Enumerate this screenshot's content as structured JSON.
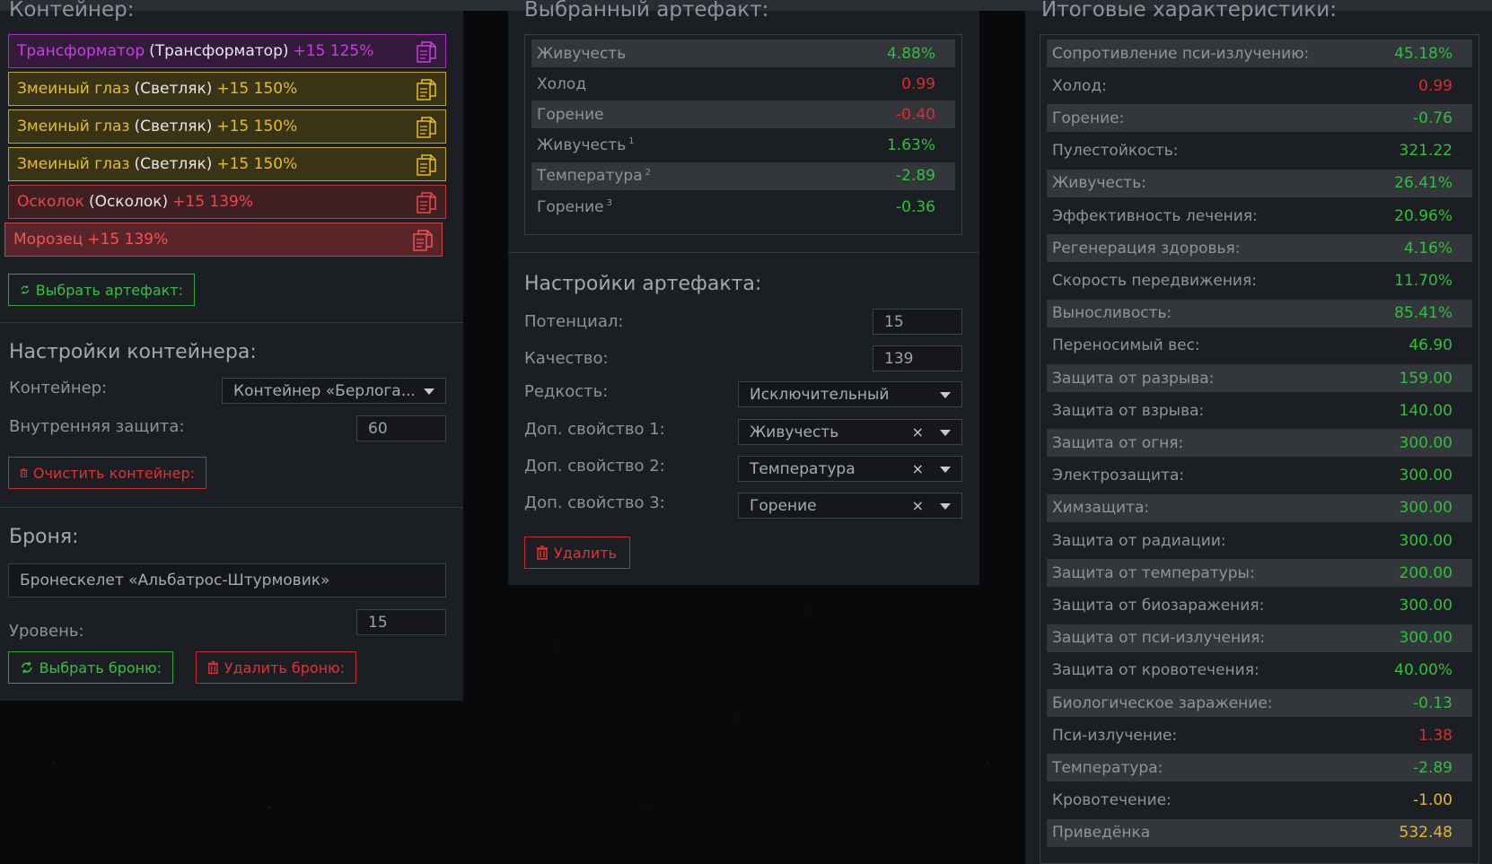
{
  "left": {
    "container_title": "Контейнер:",
    "artifacts": [
      {
        "name": "Трансформатор",
        "sub": "(Трансформатор)",
        "level": "+15 125%",
        "style": "purple"
      },
      {
        "name": "Змеиный глаз",
        "sub": "(Светляк)",
        "level": "+15 150%",
        "style": "yellow"
      },
      {
        "name": "Змеиный глаз",
        "sub": "(Светляк)",
        "level": "+15 150%",
        "style": "yellow"
      },
      {
        "name": "Змеиный глаз",
        "sub": "(Светляк)",
        "level": "+15 150%",
        "style": "yellow"
      },
      {
        "name": "Осколок",
        "sub": "(Осколок)",
        "level": "+15 139%",
        "style": "red"
      },
      {
        "name": "Морозец",
        "sub": "",
        "level": "+15 139%",
        "style": "red2"
      }
    ],
    "select_artifact_label": "Выбрать артефакт:",
    "container_settings_title": "Настройки контейнера:",
    "container_label": "Контейнер:",
    "container_value": "Контейнер «Берлога...",
    "inner_protection_label": "Внутренняя защита:",
    "inner_protection_value": "60",
    "clear_container_label": "Очистить контейнер:",
    "armor_title": "Броня:",
    "armor_value": "Бронескелет «Альбатрос-Штурмовик»",
    "level_label": "Уровень:",
    "level_value": "15",
    "select_armor_label": "Выбрать броню:",
    "delete_armor_label": "Удалить броню:"
  },
  "middle": {
    "selected_title": "Выбранный артефакт:",
    "stats": [
      {
        "name": "Живучесть",
        "sup": "",
        "value": "4.88%",
        "color": "green"
      },
      {
        "name": "Холод",
        "sup": "",
        "value": "0.99",
        "color": "red"
      },
      {
        "name": "Горение",
        "sup": "",
        "value": "-0.40",
        "color": "red"
      },
      {
        "name": "Живучесть",
        "sup": "1",
        "value": "1.63%",
        "color": "green"
      },
      {
        "name": "Температура",
        "sup": "2",
        "value": "-2.89",
        "color": "green"
      },
      {
        "name": "Горение",
        "sup": "3",
        "value": "-0.36",
        "color": "green"
      }
    ],
    "settings_title": "Настройки артефакта:",
    "potential_label": "Потенциал:",
    "potential_value": "15",
    "quality_label": "Качество:",
    "quality_value": "139",
    "rarity_label": "Редкость:",
    "rarity_value": "Исключительный",
    "extra1_label": "Доп. свойство 1:",
    "extra1_value": "Живучесть",
    "extra2_label": "Доп. свойство 2:",
    "extra2_value": "Температура",
    "extra3_label": "Доп. свойство 3:",
    "extra3_value": "Горение",
    "clear_symbol": "×",
    "delete_label": "Удалить"
  },
  "right": {
    "title": "Итоговые характеристики:",
    "stats": [
      {
        "name": "Сопротивление пси-излучению:",
        "value": "45.18%",
        "color": "green"
      },
      {
        "name": "Холод:",
        "value": "0.99",
        "color": "red"
      },
      {
        "name": "Горение:",
        "value": "-0.76",
        "color": "green"
      },
      {
        "name": "Пулестойкость:",
        "value": "321.22",
        "color": "green"
      },
      {
        "name": "Живучесть:",
        "value": "26.41%",
        "color": "green"
      },
      {
        "name": "Эффективность лечения:",
        "value": "20.96%",
        "color": "green"
      },
      {
        "name": "Регенерация здоровья:",
        "value": "4.16%",
        "color": "green"
      },
      {
        "name": "Скорость передвижения:",
        "value": "11.70%",
        "color": "green"
      },
      {
        "name": "Выносливость:",
        "value": "85.41%",
        "color": "green"
      },
      {
        "name": "Переносимый вес:",
        "value": "46.90",
        "color": "green"
      },
      {
        "name": "Защита от разрыва:",
        "value": "159.00",
        "color": "green"
      },
      {
        "name": "Защита от взрыва:",
        "value": "140.00",
        "color": "green"
      },
      {
        "name": "Защита от огня:",
        "value": "300.00",
        "color": "green"
      },
      {
        "name": "Электрозащита:",
        "value": "300.00",
        "color": "green"
      },
      {
        "name": "Химзащита:",
        "value": "300.00",
        "color": "green"
      },
      {
        "name": "Защита от радиации:",
        "value": "300.00",
        "color": "green"
      },
      {
        "name": "Защита от температуры:",
        "value": "200.00",
        "color": "green"
      },
      {
        "name": "Защита от биозаражения:",
        "value": "300.00",
        "color": "green"
      },
      {
        "name": "Защита от пси-излучения:",
        "value": "300.00",
        "color": "green"
      },
      {
        "name": "Защита от кровотечения:",
        "value": "40.00%",
        "color": "green"
      },
      {
        "name": "Биологическое заражение:",
        "value": "-0.13",
        "color": "green"
      },
      {
        "name": "Пси-излучение:",
        "value": "1.38",
        "color": "red"
      },
      {
        "name": "Температура:",
        "value": "-2.89",
        "color": "green"
      },
      {
        "name": "Кровотечение:",
        "value": "-1.00",
        "color": "yellow"
      },
      {
        "name": "Приведёнка",
        "value": "532.48",
        "color": "yellow"
      }
    ]
  },
  "icons": {
    "copy": "copy-icon",
    "refresh": "refresh-icon",
    "trash": "trash-icon",
    "dropdown": "chevron-down-icon"
  }
}
